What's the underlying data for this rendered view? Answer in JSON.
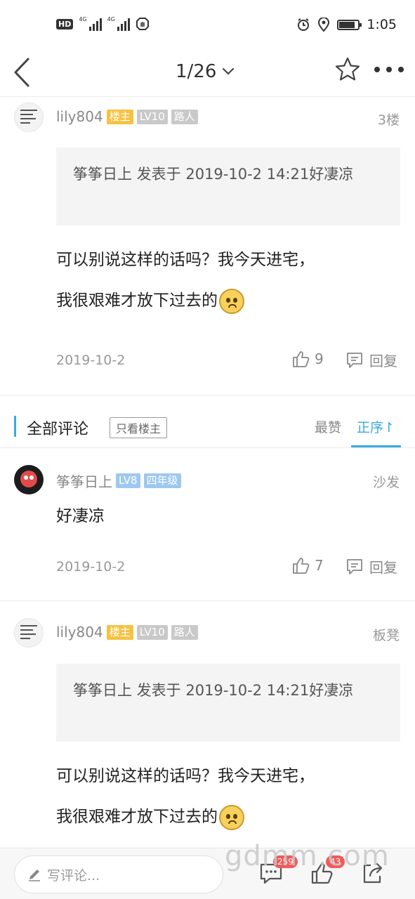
{
  "status_bar": {
    "hd_badge": "HD",
    "sim1": "4G",
    "sim2": "4G",
    "time": "1:05"
  },
  "nav": {
    "page_indicator": "1/26"
  },
  "posts": [
    {
      "username": "lily804",
      "badge_owner": "楼主",
      "badge_level": "LV10",
      "badge_title": "路人",
      "floor": "3楼",
      "quote": "筝筝日上 发表于 2019-10-2 14:21好凄凉",
      "content_line1": "可以别说这样的话吗？我今天进宅，",
      "content_line2": "我很艰难才放下过去的",
      "date": "2019-10-2",
      "likes": "9",
      "reply_label": "回复"
    },
    {
      "username": "lily804",
      "badge_owner": "楼主",
      "badge_level": "LV10",
      "badge_title": "路人",
      "floor": "板凳",
      "quote": "筝筝日上 发表于 2019-10-2 14:21好凄凉",
      "content_line1": "可以别说这样的话吗？我今天进宅，",
      "content_line2": "我很艰难才放下过去的"
    }
  ],
  "comments_header": {
    "title": "全部评论",
    "filter_label": "只看楼主",
    "sort_best": "最赞",
    "sort_order": "正序↾"
  },
  "comment": {
    "username": "筝筝日上",
    "badge_level": "LV8",
    "badge_title": "四年级",
    "floor": "沙发",
    "content": "好凄凉",
    "date": "2019-10-2",
    "likes": "7",
    "reply_label": "回复"
  },
  "bottom_bar": {
    "input_placeholder": "写评论...",
    "comment_count": "259",
    "like_count": "43"
  },
  "watermark": "gdmm.com",
  "colors": {
    "accent": "#3aa9e0",
    "owner_badge": "#f5c242",
    "level_badge": "#c9c9c9",
    "level_badge_blue": "#9ec8ef",
    "count_badge": "#f25a5a"
  },
  "icons": [
    "back-arrow-icon",
    "chevron-down-icon",
    "star-icon",
    "more-icon",
    "thumb-up-icon",
    "reply-bubble-icon",
    "pencil-icon",
    "comment-icon",
    "share-icon",
    "alarm-icon",
    "location-icon",
    "battery-icon"
  ]
}
